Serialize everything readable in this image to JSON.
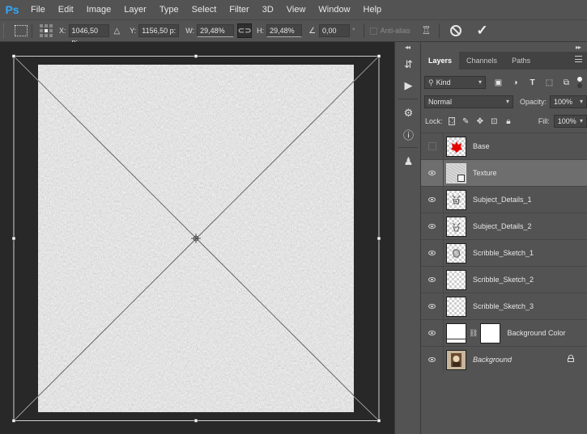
{
  "app": {
    "logo": "Ps"
  },
  "menu": [
    "File",
    "Edit",
    "Image",
    "Layer",
    "Type",
    "Select",
    "Filter",
    "3D",
    "View",
    "Window",
    "Help"
  ],
  "options": {
    "x_label": "X:",
    "x_value": "1046,50 p:",
    "delta_icon": "triangle-icon",
    "y_label": "Y:",
    "y_value": "1156,50 p:",
    "w_label": "W:",
    "w_value": "29,48%",
    "h_label": "H:",
    "h_value": "29,48%",
    "angle_value": "0,00",
    "degree": "°",
    "antialias_label": "Anti-alias",
    "accent": "#31a8ff"
  },
  "panel": {
    "tabs": [
      "Layers",
      "Channels",
      "Paths"
    ],
    "filter_kind": "Kind",
    "blend_mode": "Normal",
    "opacity_label": "Opacity:",
    "opacity_value": "100%",
    "lock_label": "Lock:",
    "fill_label": "Fill:",
    "fill_value": "100%"
  },
  "layers": [
    {
      "name": "Base",
      "visible": false,
      "thumb": "red-shape"
    },
    {
      "name": "Texture",
      "visible": true,
      "thumb": "texture",
      "selected": true
    },
    {
      "name": "Subject_Details_1",
      "visible": true,
      "thumb": "sketch"
    },
    {
      "name": "Subject_Details_2",
      "visible": true,
      "thumb": "sketch"
    },
    {
      "name": "Scribble_Sketch_1",
      "visible": true,
      "thumb": "sketch"
    },
    {
      "name": "Scribble_Sketch_2",
      "visible": true,
      "thumb": "empty"
    },
    {
      "name": "Scribble_Sketch_3",
      "visible": true,
      "thumb": "empty"
    },
    {
      "name": "Background Color",
      "visible": true,
      "thumb": "fill-with-mask"
    },
    {
      "name": "Background",
      "visible": true,
      "thumb": "image",
      "locked": true
    }
  ]
}
